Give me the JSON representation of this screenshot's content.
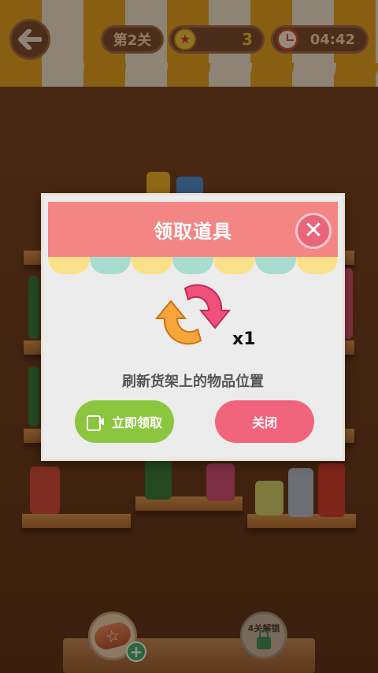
{
  "hud": {
    "level_label": "第2关",
    "stars": "3",
    "timer": "04:42"
  },
  "dialog": {
    "title": "领取道具",
    "item_quantity": "x1",
    "description": "刷新货架上的物品位置",
    "claim_button": "立即领取",
    "close_button": "关闭"
  },
  "bottom": {
    "locked_label": "4关解锁"
  },
  "colors": {
    "header": "#f48585",
    "claim": "#8cc63e",
    "close": "#f0657c"
  }
}
